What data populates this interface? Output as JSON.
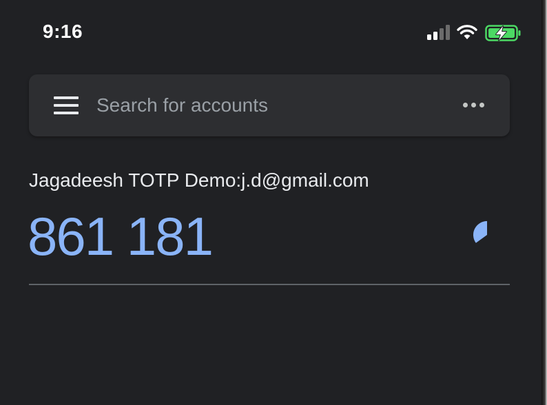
{
  "status_bar": {
    "time": "9:16"
  },
  "search": {
    "placeholder": "Search for accounts",
    "value": ""
  },
  "accounts": [
    {
      "name": "Jagadeesh TOTP Demo:j.d@gmail.com",
      "code": "861 181",
      "timer_remaining_fraction": 0.35
    }
  ],
  "icons": {
    "menu": "hamburger-menu-icon",
    "more": "more-horizontal-icon",
    "timer": "countdown-timer-icon",
    "signal": "cellular-signal-icon",
    "wifi": "wifi-icon",
    "battery": "battery-charging-icon"
  },
  "colors": {
    "background": "#202124",
    "search_bar": "#2d2e31",
    "code_accent": "#8ab4f8",
    "text_primary": "#e8eaed",
    "placeholder": "#9aa0a6",
    "battery_fill": "#4cd964"
  }
}
